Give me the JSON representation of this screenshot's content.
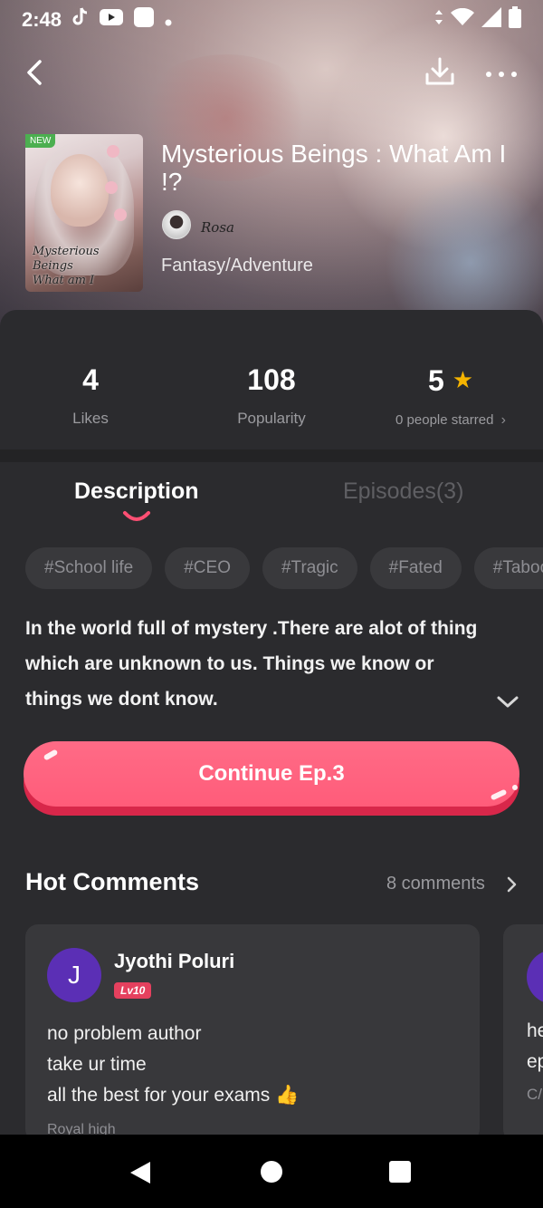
{
  "status_bar": {
    "time": "2:48",
    "icons": [
      "tiktok-icon",
      "youtube-icon",
      "notification-icon",
      "dot-icon",
      "data-arrows-icon",
      "wifi-icon",
      "signal-icon",
      "battery-icon"
    ]
  },
  "header": {
    "back_icon": "chevron-left-icon",
    "download_icon": "download-icon",
    "more_icon": "more-dots-icon"
  },
  "book": {
    "badge": "NEW",
    "cover_title_line1": "Mysterious Beings",
    "cover_title_line2": "What am I",
    "title": "Mysterious Beings : What Am I !?",
    "author": "Rosa",
    "genre": "Fantasy/Adventure"
  },
  "stats": {
    "likes_value": "4",
    "likes_label": "Likes",
    "popularity_value": "108",
    "popularity_label": "Popularity",
    "rating_value": "5",
    "rating_label": "0 people starred",
    "accent_star": "#f5b400"
  },
  "tabs": {
    "description": "Description",
    "episodes": "Episodes(3)"
  },
  "tags": [
    "#School life",
    "#CEO",
    "#Tragic",
    "#Fated",
    "#Taboo"
  ],
  "description": {
    "text": "In the world full of mystery .There are alot of thing which are unknown to us. Things we know or things we dont know."
  },
  "cta": {
    "label": "Continue Ep.3",
    "color": "#ff5c7a"
  },
  "hot_comments": {
    "title": "Hot Comments",
    "count_label": "8 comments",
    "items": [
      {
        "avatar_letter": "J",
        "username": "Jyothi Poluri",
        "level": "Lv10",
        "line1": "no problem author",
        "line2": "take ur time",
        "line3": "all the best for your exams 👍",
        "book_ref": "Royal high"
      },
      {
        "line1": "he",
        "line2": "ep",
        "line3": "C/"
      }
    ]
  }
}
